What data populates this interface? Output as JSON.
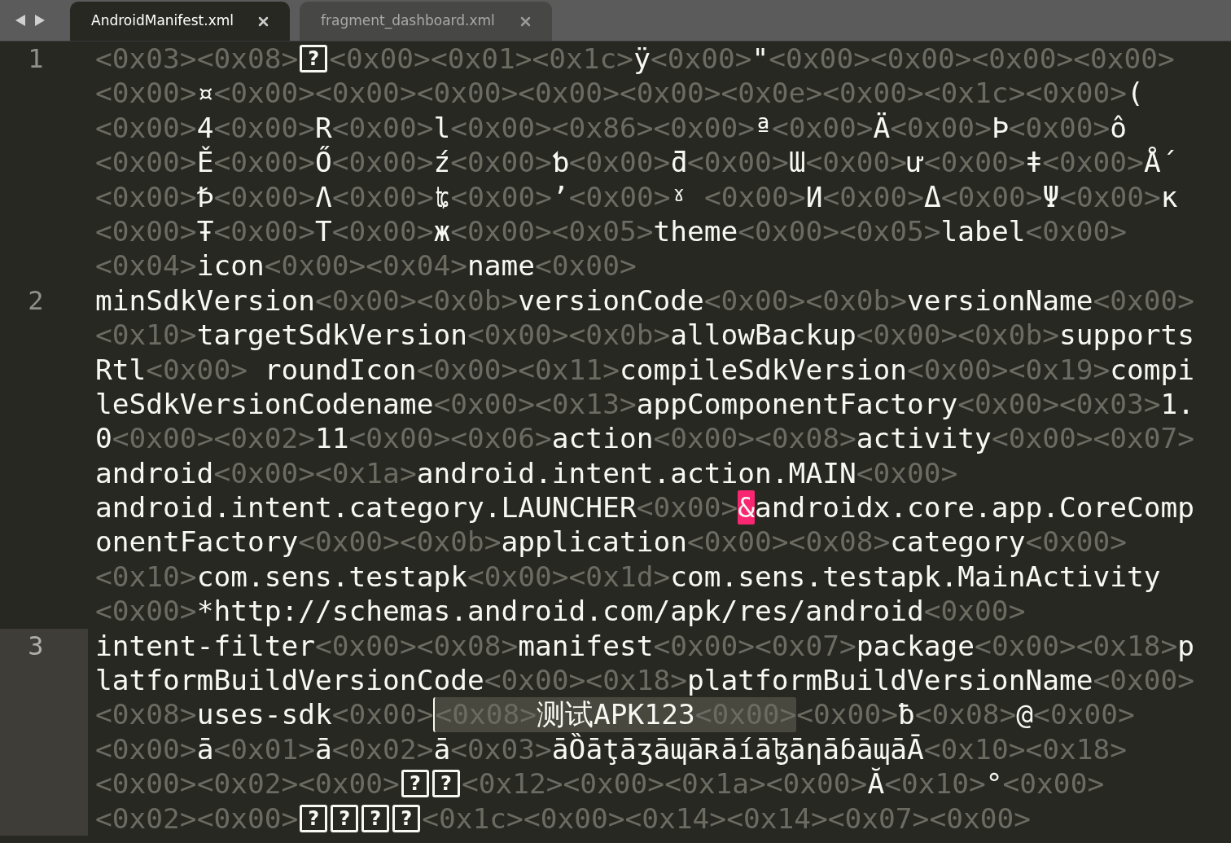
{
  "tabs": [
    {
      "label": "AndroidManifest.xml",
      "selected": true
    },
    {
      "label": "fragment_dashboard.xml",
      "selected": false
    }
  ],
  "lines": [
    {
      "number": "1",
      "current": false,
      "rows": [
        {
          "segments": [
            {
              "kind": "plain",
              "text": "<0x03><0x08>"
            },
            {
              "kind": "boxed",
              "text": "?"
            },
            {
              "kind": "plain",
              "text": "<0x00><0x01><0x1c>ÿ<0x00>\"<0x00><0x00><0x00><0x00>"
            }
          ]
        },
        {
          "segments": [
            {
              "kind": "plain",
              "text": "<0x00>¤<0x00><0x00><0x00><0x00><0x00><0x0e><0x00><0x1c><0x00>("
            }
          ]
        },
        {
          "segments": [
            {
              "kind": "plain",
              "text": "<0x00>4<0x00>R<0x00>l<0x00><0x86><0x00>ª<0x00>Ä<0x00>Þ<0x00>ô"
            }
          ]
        },
        {
          "segments": [
            {
              "kind": "plain",
              "text": "<0x00>Ě<0x00>Ő<0x00>ź<0x00>ƅ<0x00>ƌ<0x00>Ɯ<0x00>ư<0x00>ǂ<0x00>Ǻ"
            }
          ]
        },
        {
          "segments": [
            {
              "kind": "plain",
              "text": "<0x00>Ꝥ<0x00>Ʌ<0x00>ʨ<0x00>’<0x00>ˠ <0x00>И<0x00>Δ<0x00>Ψ<0x00>κ"
            }
          ]
        },
        {
          "segments": [
            {
              "kind": "plain",
              "text": "<0x00>Ŧ<0x00>T<0x00>ж<0x00><0x05>theme<0x00><0x05>label<0x00>"
            }
          ]
        },
        {
          "segments": [
            {
              "kind": "plain",
              "text": "<0x04>icon<0x00><0x04>name<0x00>"
            }
          ]
        }
      ]
    },
    {
      "number": "2",
      "current": false,
      "rows": [
        {
          "segments": [
            {
              "kind": "plain",
              "text": "minSdkVersion<0x00><0x0b>versionCode<0x00><0x0b>versionName<0x00>"
            }
          ]
        },
        {
          "segments": [
            {
              "kind": "plain",
              "text": "<0x10>targetSdkVersion<0x00><0x0b>allowBackup<0x00><0x0b>supports"
            }
          ]
        },
        {
          "segments": [
            {
              "kind": "plain",
              "text": "Rtl<0x00> roundIcon<0x00><0x11>compileSdkVersion<0x00><0x19>compi"
            }
          ]
        },
        {
          "segments": [
            {
              "kind": "plain",
              "text": "leSdkVersionCodename<0x00><0x13>appComponentFactory<0x00><0x03>1."
            }
          ]
        },
        {
          "segments": [
            {
              "kind": "plain",
              "text": "0<0x00><0x02>11<0x00><0x06>action<0x00><0x08>activity<0x00><0x07>"
            }
          ]
        },
        {
          "segments": [
            {
              "kind": "plain",
              "text": "android<0x00><0x1a>android.intent.action.MAIN<0x00>"
            }
          ]
        },
        {
          "segments": [
            {
              "kind": "plain",
              "text": "android.intent.category.LAUNCHER<0x00>"
            },
            {
              "kind": "invalid",
              "text": "&"
            },
            {
              "kind": "plain",
              "text": "androidx.core.app.CoreComp"
            }
          ]
        },
        {
          "segments": [
            {
              "kind": "plain",
              "text": "onentFactory<0x00><0x0b>application<0x00><0x08>category<0x00>"
            }
          ]
        },
        {
          "segments": [
            {
              "kind": "plain",
              "text": "<0x10>com.sens.testapk<0x00><0x1d>com.sens.testapk.MainActivity"
            }
          ]
        },
        {
          "segments": [
            {
              "kind": "plain",
              "text": "<0x00>*http://schemas.android.com/apk/res/android<0x00>"
            }
          ]
        }
      ]
    },
    {
      "number": "3",
      "current": true,
      "rows": [
        {
          "segments": [
            {
              "kind": "plain",
              "text": "intent-filter<0x00><0x08>manifest<0x00><0x07>package<0x00><0x18>p"
            }
          ]
        },
        {
          "segments": [
            {
              "kind": "plain",
              "text": "latformBuildVersionCode<0x00><0x18>platformBuildVersionName<0x00>"
            }
          ]
        },
        {
          "segments": [
            {
              "kind": "plain",
              "text": "<0x08>uses-sdk<0x00>"
            },
            {
              "kind": "selection",
              "text": "<0x08>测试APK123<0x00>"
            },
            {
              "kind": "plain",
              "text": "<0x00>ƀ<0x08>@<0x00>"
            }
          ]
        },
        {
          "segments": [
            {
              "kind": "plain",
              "text": "<0x00>ā<0x01>ā<0x02>ā<0x03>āȌāţāʒāɰāʀāíāɮāηāɓāɰāĀ<0x10><0x18>"
            }
          ]
        },
        {
          "segments": [
            {
              "kind": "plain",
              "text": "<0x00><0x02><0x00>"
            },
            {
              "kind": "boxed",
              "text": "?"
            },
            {
              "kind": "boxed",
              "text": "?"
            },
            {
              "kind": "plain",
              "text": "<0x12><0x00><0x1a><0x00>Ă<0x10>°<0x00>"
            }
          ]
        },
        {
          "segments": [
            {
              "kind": "plain",
              "text": "<0x02><0x00>"
            },
            {
              "kind": "boxed",
              "text": "?"
            },
            {
              "kind": "boxed",
              "text": "?"
            },
            {
              "kind": "boxed",
              "text": "?"
            },
            {
              "kind": "boxed",
              "text": "?"
            },
            {
              "kind": "plain",
              "text": "<0x1c><0x00><0x14><0x14><0x07><0x00>"
            }
          ]
        }
      ]
    }
  ]
}
